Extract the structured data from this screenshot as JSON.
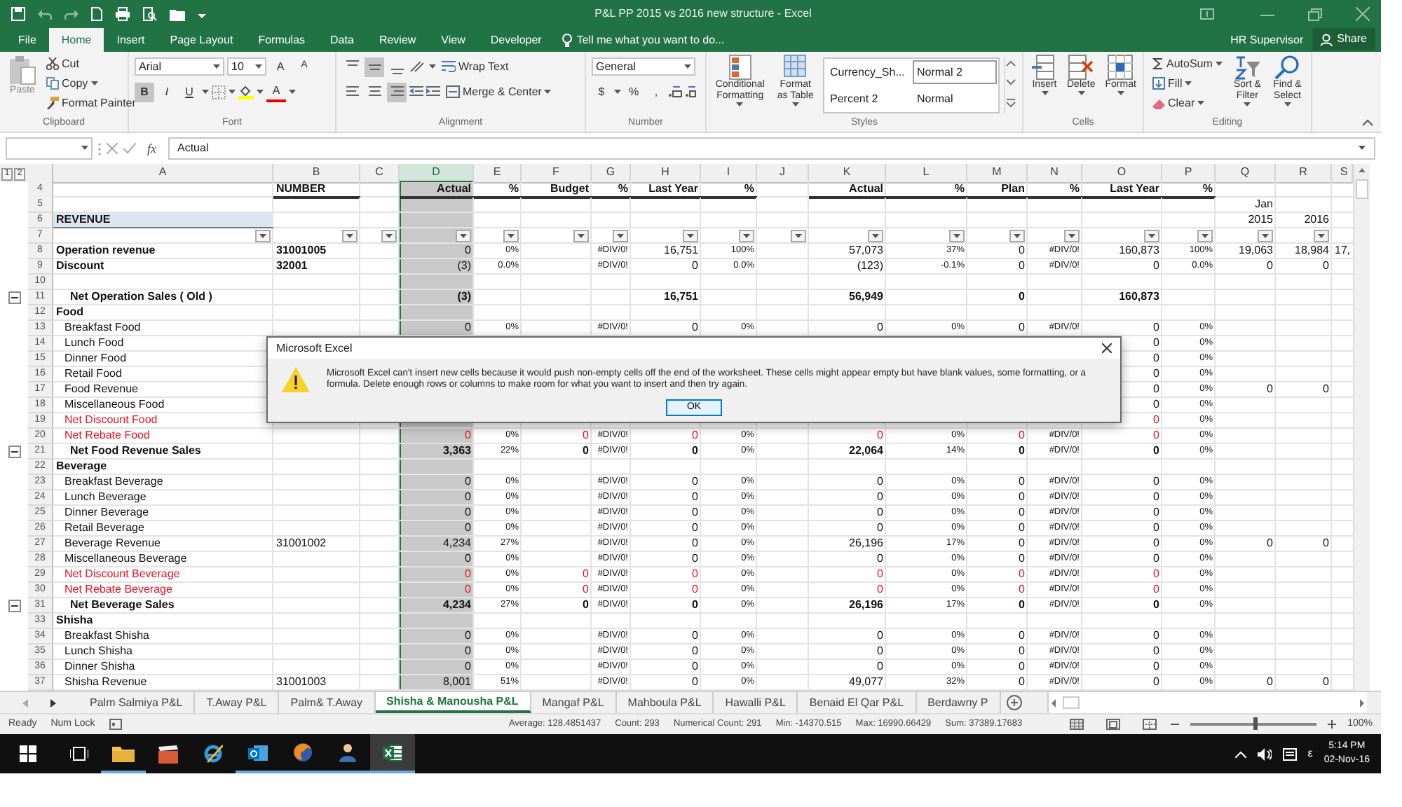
{
  "window": {
    "title": "P&L PP 2015 vs 2016 new structure - Excel"
  },
  "tabs": [
    {
      "label": "File",
      "selected": false
    },
    {
      "label": "Home",
      "selected": true
    },
    {
      "label": "Insert",
      "selected": false
    },
    {
      "label": "Page Layout",
      "selected": false
    },
    {
      "label": "Formulas",
      "selected": false
    },
    {
      "label": "Data",
      "selected": false
    },
    {
      "label": "Review",
      "selected": false
    },
    {
      "label": "View",
      "selected": false
    },
    {
      "label": "Developer",
      "selected": false
    }
  ],
  "tell_me": {
    "placeholder": "Tell me what you want to do..."
  },
  "user": "HR Supervisor",
  "share": "Share",
  "ribbon": {
    "clipboard": {
      "label": "Clipboard",
      "paste": "Paste",
      "cut": "Cut",
      "copy": "Copy",
      "format_painter": "Format Painter"
    },
    "font": {
      "label": "Font",
      "font_name": "Arial",
      "font_size": "10",
      "grow": "A",
      "shrink": "A",
      "color_letter": "A",
      "toggles": [
        {
          "label": "B",
          "selected": true
        },
        {
          "label": "I",
          "selected": false
        },
        {
          "label": "U",
          "selected": false
        }
      ]
    },
    "alignment": {
      "label": "Alignment",
      "wrap": "Wrap Text",
      "merge": "Merge & Center",
      "vertical": [
        {
          "selected": false
        },
        {
          "selected": true
        },
        {
          "selected": false
        }
      ],
      "horizontal": [
        {
          "selected": false
        },
        {
          "selected": false
        },
        {
          "selected": true
        }
      ]
    },
    "number": {
      "label": "Number",
      "format": "General",
      "currency": "$",
      "percent": "%",
      "comma": ","
    },
    "styles": {
      "label": "Styles",
      "conditional": "Conditional Formatting",
      "table": "Format as Table",
      "gallery": [
        {
          "label": "Currency_Sh...",
          "selected": false
        },
        {
          "label": "Normal 2",
          "selected": true
        },
        {
          "label": "Percent 2",
          "selected": false
        },
        {
          "label": "Normal",
          "selected": false
        }
      ]
    },
    "cells": {
      "label": "Cells",
      "buttons": [
        "Insert",
        "Delete",
        "Format"
      ]
    },
    "editing": {
      "label": "Editing",
      "autosum": "AutoSum",
      "fill": "Fill",
      "clear": "Clear",
      "sort": "Sort & Filter",
      "find": "Find & Select"
    }
  },
  "formula_bar": {
    "function_label": "fx",
    "value": "Actual"
  },
  "sheet": {
    "outline_levels": [
      "1",
      "2"
    ],
    "columns": [
      {
        "letter": "A",
        "kind": "label",
        "selected": false,
        "filter": true
      },
      {
        "letter": "B",
        "kind": "code",
        "selected": false,
        "filter": true
      },
      {
        "letter": "C",
        "kind": "value",
        "selected": false,
        "filter": true
      },
      {
        "letter": "D",
        "kind": "value",
        "selected": true,
        "filter": true
      },
      {
        "letter": "E",
        "kind": "ratio",
        "selected": false,
        "filter": true
      },
      {
        "letter": "F",
        "kind": "value",
        "selected": false,
        "filter": true
      },
      {
        "letter": "G",
        "kind": "ratio",
        "selected": false,
        "filter": true
      },
      {
        "letter": "H",
        "kind": "value",
        "selected": false,
        "filter": true
      },
      {
        "letter": "I",
        "kind": "ratio",
        "selected": false,
        "filter": true
      },
      {
        "letter": "J",
        "kind": "value",
        "selected": false,
        "filter": true
      },
      {
        "letter": "K",
        "kind": "value",
        "selected": false,
        "filter": true
      },
      {
        "letter": "L",
        "kind": "ratio",
        "selected": false,
        "filter": true
      },
      {
        "letter": "M",
        "kind": "value",
        "selected": false,
        "filter": true
      },
      {
        "letter": "N",
        "kind": "ratio",
        "selected": false,
        "filter": true
      },
      {
        "letter": "O",
        "kind": "value",
        "selected": false,
        "filter": true
      },
      {
        "letter": "P",
        "kind": "ratio",
        "selected": false,
        "filter": true
      },
      {
        "letter": "Q",
        "kind": "value",
        "selected": false,
        "filter": true
      },
      {
        "letter": "R",
        "kind": "value",
        "selected": false,
        "filter": true
      },
      {
        "letter": "S",
        "kind": "partial",
        "selected": false,
        "filter": false
      }
    ],
    "rows": [
      {
        "number": "4",
        "kind": "heading",
        "cells": {
          "B": "NUMBER",
          "D": "Actual",
          "E": "%",
          "F": "Budget",
          "G": "%",
          "H": "Last Year",
          "I": "%",
          "K": "Actual",
          "L": "%",
          "M": "Plan",
          "N": "%",
          "O": "Last Year",
          "P": "%"
        }
      },
      {
        "number": "5",
        "kind": "blank",
        "cells": {
          "Q": "Jan"
        }
      },
      {
        "number": "6",
        "kind": "title",
        "cells": {
          "A": "REVENUE",
          "Q": "2015",
          "R": "2016"
        }
      },
      {
        "number": "7",
        "kind": "filter",
        "cells": {}
      },
      {
        "number": "8",
        "kind": "main",
        "cells": {
          "A": "Operation revenue",
          "B": "31001005",
          "D": "0",
          "E": "0%",
          "G": "#DIV/0!",
          "H": "16,751",
          "I": "100%",
          "K": "57,073",
          "L": "37%",
          "M": "0",
          "N": "#DIV/0!",
          "O": "160,873",
          "P": "100%",
          "Q": "19,063",
          "R": "18,984",
          "S": "17,"
        }
      },
      {
        "number": "9",
        "kind": "main",
        "cells": {
          "A": "Discount",
          "B": "32001",
          "D": "(3)",
          "E": "0.0%",
          "G": "#DIV/0!",
          "H": "0",
          "I": "0.0%",
          "K": "(123)",
          "L": "-0.1%",
          "M": "0",
          "N": "#DIV/0!",
          "O": "0",
          "P": "0.0%",
          "Q": "0",
          "R": "0"
        }
      },
      {
        "number": "10",
        "kind": "blank",
        "cells": {}
      },
      {
        "number": "11",
        "kind": "total",
        "cells": {
          "A": "Net Operation Sales ( Old )",
          "D": "(3)",
          "H": "16,751",
          "K": "56,949",
          "M": "0",
          "O": "160,873"
        }
      },
      {
        "number": "12",
        "kind": "section",
        "cells": {
          "A": "Food"
        }
      },
      {
        "number": "13",
        "kind": "item",
        "cells": {
          "A": "Breakfast Food",
          "D": "0",
          "E": "0%",
          "G": "#DIV/0!",
          "H": "0",
          "I": "0%",
          "K": "0",
          "L": "0%",
          "M": "0",
          "N": "#DIV/0!",
          "O": "0",
          "P": "0%"
        }
      },
      {
        "number": "14",
        "kind": "item",
        "cells": {
          "A": "Lunch Food",
          "O": "0",
          "P": "0%"
        }
      },
      {
        "number": "15",
        "kind": "item",
        "cells": {
          "A": "Dinner Food",
          "O": "0",
          "P": "0%"
        }
      },
      {
        "number": "16",
        "kind": "item",
        "cells": {
          "A": "Retail Food",
          "O": "0",
          "P": "0%"
        }
      },
      {
        "number": "17",
        "kind": "item",
        "cells": {
          "A": "Food Revenue",
          "O": "0",
          "P": "0%",
          "Q": "0",
          "R": "0"
        }
      },
      {
        "number": "18",
        "kind": "item",
        "cells": {
          "A": "Miscellaneous Food",
          "O": "0",
          "P": "0%"
        }
      },
      {
        "number": "19",
        "kind": "deduction",
        "cells": {
          "A": "Net Discount Food",
          "O": "0",
          "P": "0%"
        }
      },
      {
        "number": "20",
        "kind": "deduction",
        "cells": {
          "A": "Net Rebate Food",
          "D": "0",
          "E": "0%",
          "F": "0",
          "G": "#DIV/0!",
          "H": "0",
          "I": "0%",
          "K": "0",
          "L": "0%",
          "M": "0",
          "N": "#DIV/0!",
          "O": "0",
          "P": "0%"
        }
      },
      {
        "number": "21",
        "kind": "total",
        "cells": {
          "A": "Net Food Revenue Sales",
          "D": "3,363",
          "E": "22%",
          "F": "0",
          "G": "#DIV/0!",
          "H": "0",
          "I": "0%",
          "K": "22,064",
          "L": "14%",
          "M": "0",
          "N": "#DIV/0!",
          "O": "0",
          "P": "0%"
        }
      },
      {
        "number": "22",
        "kind": "section",
        "cells": {
          "A": "Beverage"
        }
      },
      {
        "number": "23",
        "kind": "item",
        "cells": {
          "A": "Breakfast Beverage",
          "D": "0",
          "E": "0%",
          "G": "#DIV/0!",
          "H": "0",
          "I": "0%",
          "K": "0",
          "L": "0%",
          "M": "0",
          "N": "#DIV/0!",
          "O": "0",
          "P": "0%"
        }
      },
      {
        "number": "24",
        "kind": "item",
        "cells": {
          "A": "Lunch Beverage",
          "D": "0",
          "E": "0%",
          "G": "#DIV/0!",
          "H": "0",
          "I": "0%",
          "K": "0",
          "L": "0%",
          "M": "0",
          "N": "#DIV/0!",
          "O": "0",
          "P": "0%"
        }
      },
      {
        "number": "25",
        "kind": "item",
        "cells": {
          "A": "Dinner Beverage",
          "D": "0",
          "E": "0%",
          "G": "#DIV/0!",
          "H": "0",
          "I": "0%",
          "K": "0",
          "L": "0%",
          "M": "0",
          "N": "#DIV/0!",
          "O": "0",
          "P": "0%"
        }
      },
      {
        "number": "26",
        "kind": "item",
        "cells": {
          "A": "Retail Beverage",
          "D": "0",
          "E": "0%",
          "G": "#DIV/0!",
          "H": "0",
          "I": "0%",
          "K": "0",
          "L": "0%",
          "M": "0",
          "N": "#DIV/0!",
          "O": "0",
          "P": "0%"
        }
      },
      {
        "number": "27",
        "kind": "item",
        "cells": {
          "A": "Beverage Revenue",
          "B": "31001002",
          "D": "4,234",
          "E": "27%",
          "G": "#DIV/0!",
          "H": "0",
          "I": "0%",
          "K": "26,196",
          "L": "17%",
          "M": "0",
          "N": "#DIV/0!",
          "O": "0",
          "P": "0%",
          "Q": "0",
          "R": "0"
        }
      },
      {
        "number": "28",
        "kind": "item",
        "cells": {
          "A": "Miscellaneous Beverage",
          "D": "0",
          "E": "0%",
          "G": "#DIV/0!",
          "H": "0",
          "I": "0%",
          "K": "0",
          "L": "0%",
          "M": "0",
          "N": "#DIV/0!",
          "O": "0",
          "P": "0%"
        }
      },
      {
        "number": "29",
        "kind": "deduction",
        "cells": {
          "A": "Net Discount Beverage",
          "D": "0",
          "E": "0%",
          "F": "0",
          "G": "#DIV/0!",
          "H": "0",
          "I": "0%",
          "K": "0",
          "L": "0%",
          "M": "0",
          "N": "#DIV/0!",
          "O": "0",
          "P": "0%"
        }
      },
      {
        "number": "30",
        "kind": "deduction",
        "cells": {
          "A": "Net Rebate Beverage",
          "D": "0",
          "E": "0%",
          "F": "0",
          "G": "#DIV/0!",
          "H": "0",
          "I": "0%",
          "K": "0",
          "L": "0%",
          "M": "0",
          "N": "#DIV/0!",
          "O": "0",
          "P": "0%"
        }
      },
      {
        "number": "31",
        "kind": "total",
        "cells": {
          "A": "Net Beverage Sales",
          "D": "4,234",
          "E": "27%",
          "F": "0",
          "G": "#DIV/0!",
          "H": "0",
          "I": "0%",
          "K": "26,196",
          "L": "17%",
          "M": "0",
          "N": "#DIV/0!",
          "O": "0",
          "P": "0%"
        }
      },
      {
        "number": "33",
        "kind": "section",
        "cells": {
          "A": "Shisha"
        }
      },
      {
        "number": "34",
        "kind": "item",
        "cells": {
          "A": "Breakfast Shisha",
          "D": "0",
          "E": "0%",
          "G": "#DIV/0!",
          "H": "0",
          "I": "0%",
          "K": "0",
          "L": "0%",
          "M": "0",
          "N": "#DIV/0!",
          "O": "0",
          "P": "0%"
        }
      },
      {
        "number": "35",
        "kind": "item",
        "cells": {
          "A": "Lunch Shisha",
          "D": "0",
          "E": "0%",
          "G": "#DIV/0!",
          "H": "0",
          "I": "0%",
          "K": "0",
          "L": "0%",
          "M": "0",
          "N": "#DIV/0!",
          "O": "0",
          "P": "0%"
        }
      },
      {
        "number": "36",
        "kind": "item",
        "cells": {
          "A": "Dinner Shisha",
          "D": "0",
          "E": "0%",
          "G": "#DIV/0!",
          "H": "0",
          "I": "0%",
          "K": "0",
          "L": "0%",
          "M": "0",
          "N": "#DIV/0!",
          "O": "0",
          "P": "0%"
        }
      },
      {
        "number": "37",
        "kind": "item",
        "cells": {
          "A": "Shisha Revenue",
          "B": "31001003",
          "D": "8,001",
          "E": "51%",
          "G": "#DIV/0!",
          "H": "0",
          "I": "0%",
          "K": "49,077",
          "L": "32%",
          "M": "0",
          "N": "#DIV/0!",
          "O": "0",
          "P": "0%",
          "Q": "0",
          "R": "0"
        }
      }
    ]
  },
  "dialog": {
    "title": "Microsoft Excel",
    "message": "Microsoft Excel can't insert new cells because it would push non-empty cells off the end of the worksheet. These cells might appear empty but have blank values, some formatting, or a formula. Delete enough rows or columns to make room for what you want to insert and then try again.",
    "button": "OK"
  },
  "sheet_tabs": [
    {
      "label": "Palm Salmiya P&L",
      "selected": false
    },
    {
      "label": "T.Away P&L",
      "selected": false
    },
    {
      "label": "Palm& T.Away",
      "selected": false
    },
    {
      "label": "Shisha & Manousha P&L",
      "selected": true
    },
    {
      "label": "Mangaf P&L",
      "selected": false
    },
    {
      "label": "Mahboula P&L",
      "selected": false
    },
    {
      "label": "Hawalli P&L",
      "selected": false
    },
    {
      "label": "Benaid El Qar P&L",
      "selected": false
    },
    {
      "label": "Berdawny P",
      "selected": false
    }
  ],
  "status_bar": {
    "mode": "Ready",
    "num_lock": "Num Lock",
    "stats": [
      "Average: 128.4851437",
      "Count: 293",
      "Numerical Count: 291",
      "Min: -14370.515",
      "Max: 16990.66429",
      "Sum: 37389.17683"
    ],
    "zoom_slider": {
      "level": 0.5
    },
    "zoom": "100%"
  },
  "taskbar": {
    "apps": [
      {
        "running": true,
        "selected": false
      },
      {
        "running": false,
        "selected": false
      },
      {
        "running": false,
        "selected": false
      },
      {
        "running": true,
        "selected": false
      },
      {
        "running": true,
        "selected": false
      },
      {
        "running": true,
        "selected": false
      },
      {
        "running": true,
        "selected": true
      }
    ],
    "input_indicator": "ε",
    "time": "5:14 PM",
    "date": "02-Nov-16"
  }
}
